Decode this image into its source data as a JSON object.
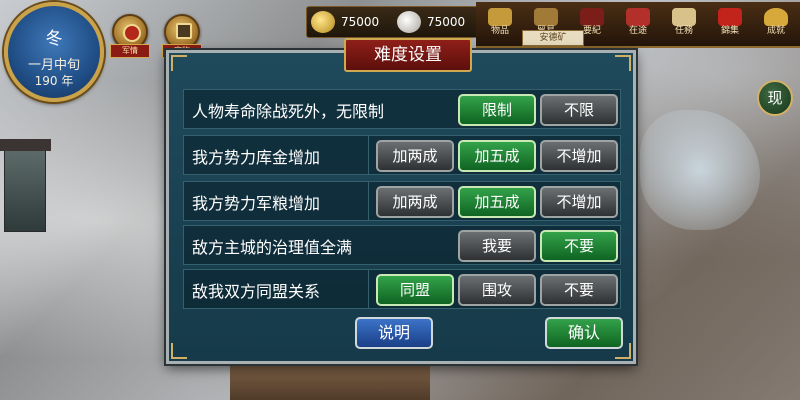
{
  "hud": {
    "season": "冬",
    "month": "一月中旬",
    "year": "190 年",
    "badges": [
      {
        "label": "军情",
        "icon": "military-intel-icon"
      },
      {
        "label": "宝物",
        "icon": "treasure-icon"
      }
    ],
    "resources": [
      {
        "name": "gold",
        "value": "75000",
        "icon": "gold-icon"
      },
      {
        "name": "grain",
        "value": "75000",
        "icon": "grain-icon"
      }
    ],
    "menu": [
      {
        "label": "物品",
        "icon": "items-icon"
      },
      {
        "label": "贸易",
        "icon": "trade-icon"
      },
      {
        "label": "要紀",
        "icon": "records-icon"
      },
      {
        "label": "在途",
        "icon": "in-transit-icon"
      },
      {
        "label": "任務",
        "icon": "quest-icon"
      },
      {
        "label": "錦集",
        "icon": "collection-icon"
      },
      {
        "label": "成就",
        "icon": "achievement-icon"
      }
    ],
    "map_plaque": "安德矿",
    "side_button": "现"
  },
  "dialog": {
    "title": "难度设置",
    "rows": [
      {
        "label": "人物寿命除战死外，无限制",
        "options": [
          "限制",
          "不限"
        ],
        "selected": "限制"
      },
      {
        "label": "我方势力库金增加",
        "options": [
          "加两成",
          "加五成",
          "不增加"
        ],
        "selected": "加五成"
      },
      {
        "label": "我方势力军粮增加",
        "options": [
          "加两成",
          "加五成",
          "不增加"
        ],
        "selected": "加五成"
      },
      {
        "label": "敌方主城的治理值全满",
        "options": [
          "我要",
          "不要"
        ],
        "selected": "不要"
      },
      {
        "label": "敌我双方同盟关系",
        "options": [
          "同盟",
          "围攻",
          "不要"
        ],
        "selected": "同盟"
      }
    ],
    "help_button": "说明",
    "confirm_button": "确认"
  },
  "colors": {
    "dialog_bg": "#1f4a5c",
    "selected_green": "#33a24a",
    "unselected_gray": "#6c6f71",
    "help_blue": "#3c73c9",
    "title_red": "#8f1f19"
  }
}
